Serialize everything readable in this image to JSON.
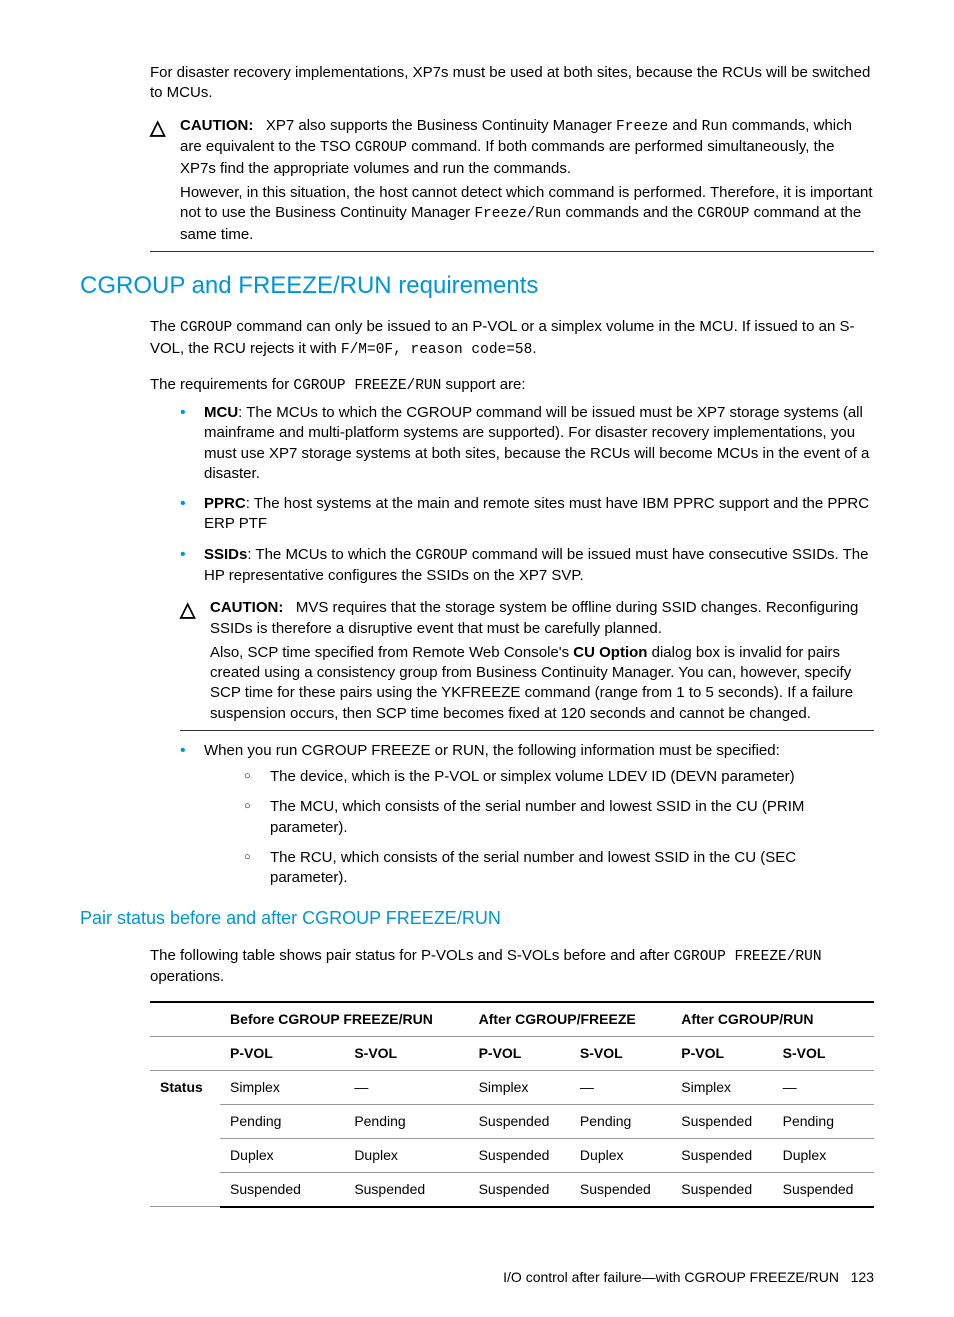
{
  "intro": "For disaster recovery implementations, XP7s must be used at both sites, because the RCUs will be switched to MCUs.",
  "caution1": {
    "label": "CAUTION:",
    "p1a": "XP7 also supports the Business Continuity Manager ",
    "p1b": " and ",
    "p1c": " commands, which are equivalent to the TSO ",
    "p1d": " command. If both commands are performed simultaneously, the XP7s find the appropriate volumes and run the commands.",
    "code_freeze": "Freeze",
    "code_run": "Run",
    "code_cgroup": "CGROUP",
    "p2a": "However, in this situation, the host cannot detect which command is performed. Therefore, it is important not to use the Business Continuity Manager ",
    "p2b": " commands and the ",
    "p2c": " command at the same time.",
    "code_freezerun": "Freeze/Run"
  },
  "h2": "CGROUP and FREEZE/RUN requirements",
  "sec1": {
    "p1a": "The ",
    "p1b": " command can only be issued to an P-VOL or a simplex volume in the MCU. If issued to an S-VOL, the RCU rejects it with ",
    "p1c": ".",
    "code_cgroup": "CGROUP",
    "code_fm": "F/M=0F, reason code=58",
    "p2a": "The requirements for ",
    "p2b": " support are:",
    "code_cfr": "CGROUP FREEZE/RUN"
  },
  "bullets1": {
    "mcu_label": "MCU",
    "mcu_text": ": The MCUs to which the CGROUP command will be issued must be XP7 storage systems (all mainframe and multi-platform systems are supported). For disaster recovery implementations, you must use XP7 storage systems at both sites, because the RCUs will become MCUs in the event of a disaster.",
    "pprc_label": "PPRC",
    "pprc_text": ": The host systems at the main and remote sites must have IBM PPRC support and the PPRC ERP PTF",
    "ssids_label": "SSIDs",
    "ssids_text_a": ": The MCUs to which the ",
    "ssids_code": "CGROUP",
    "ssids_text_b": " command will be issued must have consecutive SSIDs. The HP representative configures the SSIDs on the XP7 SVP."
  },
  "caution2": {
    "label": "CAUTION:",
    "p1": "MVS requires that the storage system be offline during SSID changes. Reconfiguring SSIDs is therefore a disruptive event that must be carefully planned.",
    "p2a": "Also, SCP time specified from Remote Web Console's ",
    "p2bold": "CU Option",
    "p2b": " dialog box is invalid for pairs created using a consistency group from Business Continuity Manager. You can, however, specify SCP time for these pairs using the YKFREEZE command (range from 1 to 5 seconds). If a failure suspension occurs, then SCP time becomes fixed at 120 seconds and cannot be changed."
  },
  "bullets2": {
    "top": "When you run CGROUP FREEZE or RUN, the following information must be specified:",
    "sub1": "The device, which is the P-VOL or simplex volume LDEV ID (DEVN parameter)",
    "sub2": "The MCU, which consists of the serial number and lowest SSID in the CU (PRIM parameter).",
    "sub3": "The RCU, which consists of the serial number and lowest SSID in the CU (SEC parameter)."
  },
  "h3": "Pair status before and after CGROUP FREEZE/RUN",
  "sec2": {
    "p1a": "The following table shows pair status for P-VOLs and S-VOLs before and after ",
    "p1code": "CGROUP FREEZE/RUN",
    "p1b": " operations."
  },
  "table": {
    "group_headers": [
      "",
      "Before CGROUP FREEZE/RUN",
      "After CGROUP/FREEZE",
      "After CGROUP/RUN"
    ],
    "sub_headers": [
      "",
      "P-VOL",
      "S-VOL",
      "P-VOL",
      "S-VOL",
      "P-VOL",
      "S-VOL"
    ],
    "rowhead": "Status",
    "rows": [
      [
        "Simplex",
        "—",
        "Simplex",
        "—",
        "Simplex",
        "—"
      ],
      [
        "Pending",
        "Pending",
        "Suspended",
        "Pending",
        "Suspended",
        "Pending"
      ],
      [
        "Duplex",
        "Duplex",
        "Suspended",
        "Duplex",
        "Suspended",
        "Duplex"
      ],
      [
        "Suspended",
        "Suspended",
        "Suspended",
        "Suspended",
        "Suspended",
        "Suspended"
      ]
    ]
  },
  "footer": {
    "text": "I/O control after failure—with CGROUP FREEZE/RUN",
    "page": "123"
  }
}
